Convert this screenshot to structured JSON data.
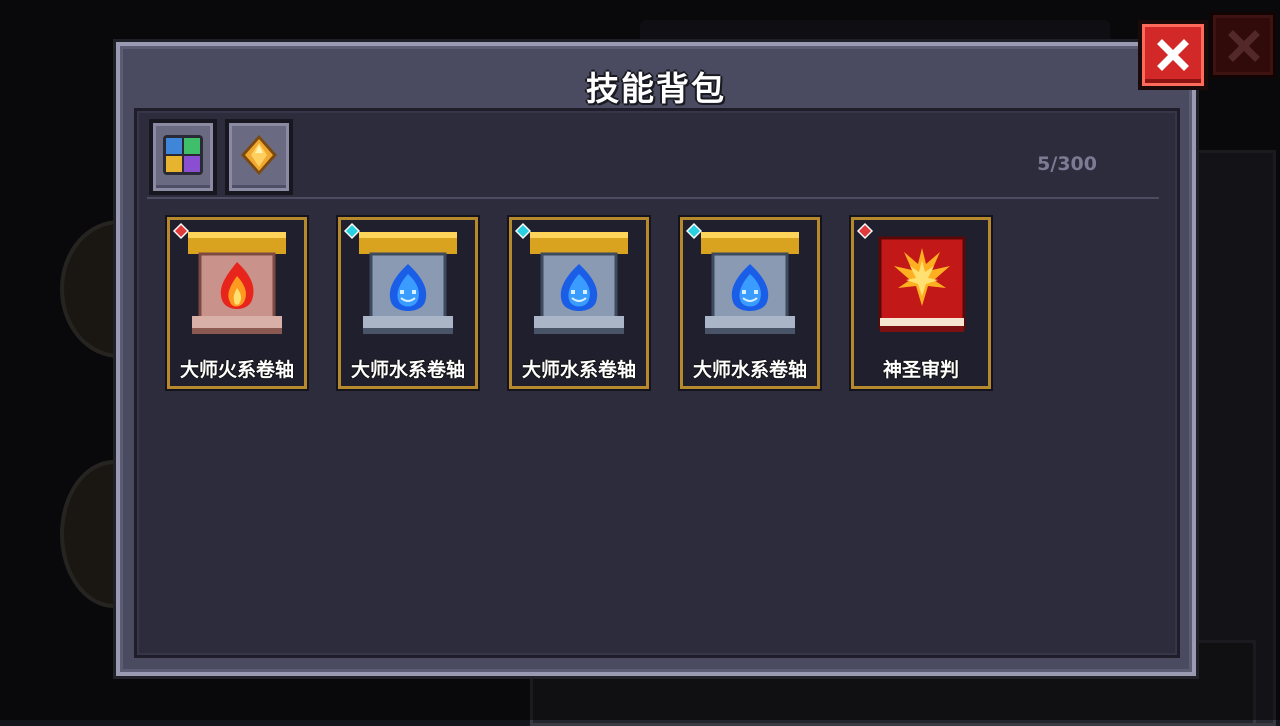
{
  "dialog": {
    "title": "技能背包",
    "counter": "5/300"
  },
  "filters": [
    {
      "name": "all-category-icon"
    },
    {
      "name": "gem-category-icon"
    }
  ],
  "skills": [
    {
      "label": "大师火系卷轴",
      "element": "fire",
      "gem_color": "#e03a3a"
    },
    {
      "label": "大师水系卷轴",
      "element": "water",
      "gem_color": "#2ad0e0"
    },
    {
      "label": "大师水系卷轴",
      "element": "water",
      "gem_color": "#2ad0e0"
    },
    {
      "label": "大师水系卷轴",
      "element": "water",
      "gem_color": "#2ad0e0"
    },
    {
      "label": "神圣审判",
      "element": "holy",
      "gem_color": "#e03a3a"
    }
  ],
  "colors": {
    "card_border": "#b68a2c",
    "close_red": "#d22828"
  }
}
